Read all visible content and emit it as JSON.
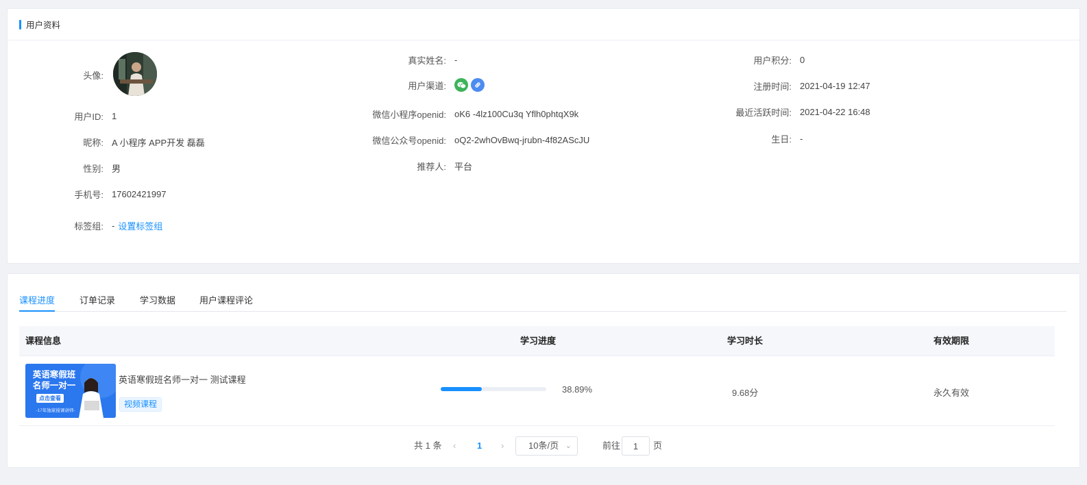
{
  "profile": {
    "section_title": "用户资料",
    "avatar_label": "头像:",
    "user_id_label": "用户ID:",
    "user_id": "1",
    "nickname_label": "昵称:",
    "nickname": "A 小程序 APP开发 磊磊",
    "gender_label": "性别:",
    "gender": "男",
    "phone_label": "手机号:",
    "phone": "17602421997",
    "tag_group_label": "标签组:",
    "tag_group_value": "-",
    "set_tags_link": "设置标签组",
    "real_name_label": "真实姓名:",
    "real_name": "-",
    "channel_label": "用户渠道:",
    "channels": [
      "wechat-icon",
      "link-icon"
    ],
    "mini_openid_label": "微信小程序openid:",
    "mini_openid": "oK6 -4lz100Cu3q Yflh0phtqX9k",
    "mp_openid_label": "微信公众号openid:",
    "mp_openid": "oQ2-2whOvBwq-jrubn-4f82AScJU",
    "referrer_label": "推荐人:",
    "referrer": "平台",
    "points_label": "用户积分:",
    "points": "0",
    "register_label": "注册时间:",
    "register_time": "2021-04-19 12:47",
    "active_label": "最近活跃时间:",
    "active_time": "2021-04-22 16:48",
    "birthday_label": "生日:",
    "birthday": "-"
  },
  "tabs": [
    {
      "label": "课程进度",
      "active": true
    },
    {
      "label": "订单记录",
      "active": false
    },
    {
      "label": "学习数据",
      "active": false
    },
    {
      "label": "用户课程评论",
      "active": false
    }
  ],
  "table": {
    "headers": {
      "info": "课程信息",
      "progress": "学习进度",
      "duration": "学习时长",
      "validity": "有效期限"
    },
    "rows": [
      {
        "title": "英语寒假班名师一对一 测试课程",
        "tag": "视频课程",
        "progress_text": "38.89%",
        "progress_value": 0.3889,
        "duration": "9.68分",
        "validity": "永久有效",
        "thumb": {
          "line1": "英语寒假班",
          "line2": "名师一对一",
          "button": "点击查看",
          "bottom": "-17年独家授课讲师-"
        }
      }
    ]
  },
  "pagination": {
    "total": "共 1 条",
    "current": "1",
    "page_size": "10条/页",
    "goto_prefix": "前往",
    "goto_value": "1",
    "goto_suffix": "页"
  },
  "colors": {
    "accent": "#1890ff",
    "wechat": "#3db35a",
    "link": "#4c8cf0"
  }
}
